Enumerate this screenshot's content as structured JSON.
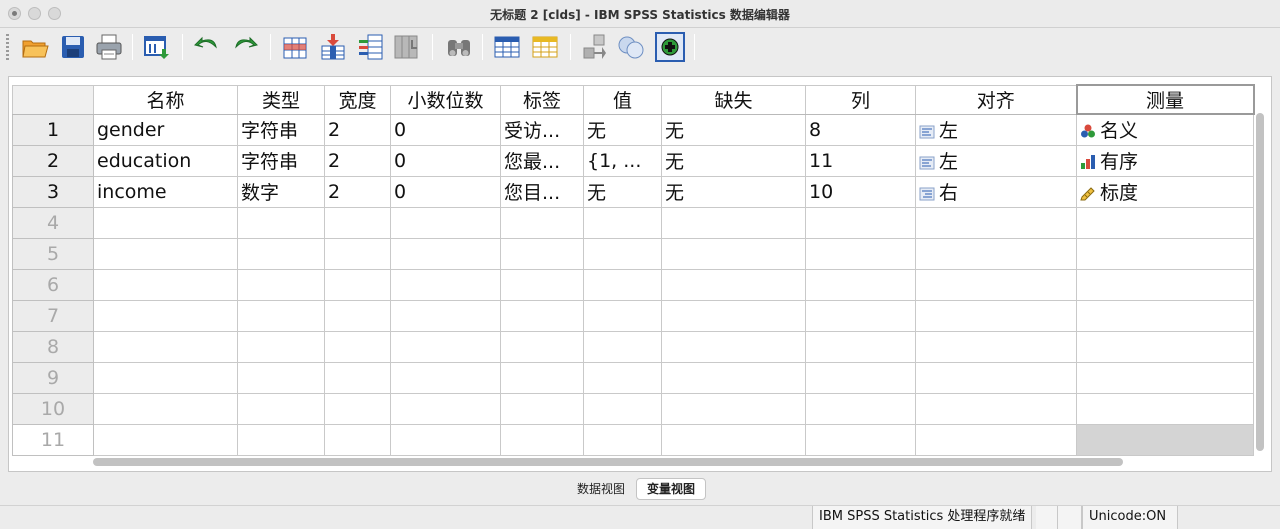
{
  "window": {
    "title": "无标题 2 [clds] - IBM SPSS Statistics 数据编辑器"
  },
  "toolbar": {
    "icons": [
      "open-folder-icon",
      "save-icon",
      "print-icon",
      "recall-dialog-icon",
      "undo-icon",
      "redo-icon",
      "goto-case-icon",
      "goto-variable-icon",
      "variables-icon",
      "run-descriptives-icon",
      "find-icon",
      "insert-cases-icon",
      "insert-variable-icon",
      "split-file-icon",
      "weight-cases-icon",
      "select-cases-icon",
      "value-labels-icon",
      "use-sets-icon"
    ]
  },
  "grid": {
    "columns": [
      "名称",
      "类型",
      "宽度",
      "小数位数",
      "标签",
      "值",
      "缺失",
      "列",
      "对齐",
      "测量"
    ],
    "rows": [
      {
        "num": "1",
        "name": "gender",
        "type": "字符串",
        "width": "2",
        "decimals": "0",
        "label": "受访...",
        "values": "无",
        "missing": "无",
        "columns": "8",
        "align": "左",
        "align_icon": "align-left-icon",
        "measure": "名义",
        "measure_icon": "nominal-icon"
      },
      {
        "num": "2",
        "name": "education",
        "type": "字符串",
        "width": "2",
        "decimals": "0",
        "label": "您最...",
        "values": "{1, ...",
        "missing": "无",
        "columns": "11",
        "align": "左",
        "align_icon": "align-left-icon",
        "measure": "有序",
        "measure_icon": "ordinal-icon"
      },
      {
        "num": "3",
        "name": "income",
        "type": "数字",
        "width": "2",
        "decimals": "0",
        "label": "您目...",
        "values": "无",
        "missing": "无",
        "columns": "10",
        "align": "右",
        "align_icon": "align-right-icon",
        "measure": "标度",
        "measure_icon": "scale-icon"
      }
    ],
    "empty_rows": [
      "4",
      "5",
      "6",
      "7",
      "8",
      "9",
      "10",
      "11"
    ]
  },
  "tabs": {
    "data_view": "数据视图",
    "variable_view": "变量视图",
    "active": "变量视图"
  },
  "status": {
    "processor": "IBM SPSS Statistics 处理程序就绪",
    "unicode": "Unicode:ON"
  },
  "colors": {
    "accent_blue": "#2a5db0",
    "folder_orange": "#f0a030",
    "green_arrow": "#2e9a3a",
    "row_header_bg": "#ececec"
  }
}
